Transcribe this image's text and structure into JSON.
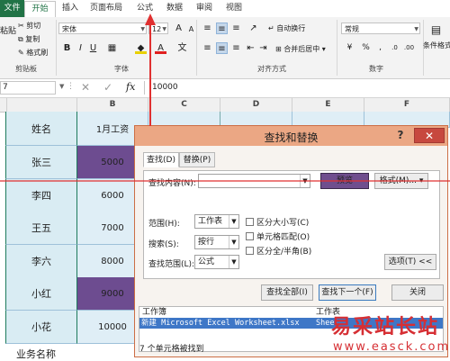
{
  "ribbon_tabs": [
    "文件",
    "开始",
    "插入",
    "页面布局",
    "公式",
    "数据",
    "审阅",
    "视图"
  ],
  "clipboard": {
    "cut": "剪切",
    "copy": "复制",
    "painter": "格式刷",
    "paste": "粘贴",
    "label": "剪贴板"
  },
  "font": {
    "name": "宋体",
    "size": "12",
    "label": "字体",
    "bold": "B",
    "italic": "I",
    "underline": "U",
    "grow": "A",
    "shrink": "A",
    "wen": "文"
  },
  "alignment": {
    "wrap": "自动换行",
    "merge": "合并后居中",
    "label": "对齐方式"
  },
  "number": {
    "format": "常规",
    "label": "数字"
  },
  "styles": {
    "cond": "条件格式"
  },
  "formula_bar": {
    "name_box": "7",
    "cancel": "✕",
    "enter": "✓",
    "fx": "fx",
    "value": "10000"
  },
  "columns": [
    "B",
    "C",
    "D",
    "E",
    "F"
  ],
  "sheet": {
    "header_name": "姓名",
    "header_salary": "1月工资",
    "rows": [
      {
        "name": "张三",
        "salary": "5000",
        "highlight": true
      },
      {
        "name": "李四",
        "salary": "6000",
        "highlight": false
      },
      {
        "name": "王五",
        "salary": "7000",
        "highlight": false
      },
      {
        "name": "李六",
        "salary": "8000",
        "highlight": false
      },
      {
        "name": "小红",
        "salary": "9000",
        "highlight": true
      },
      {
        "name": "小花",
        "salary": "10000",
        "highlight": false
      }
    ],
    "footer": "业务名称"
  },
  "dialog": {
    "title": "查找和替换",
    "help": "?",
    "close": "✕",
    "tab_find": "查找(D)",
    "tab_replace": "替换(P)",
    "find_label": "查找内容(N):",
    "preview": "预览",
    "format_btn": "格式(M)...",
    "scope_label": "范围(H):",
    "scope_value": "工作表",
    "search_label": "搜索(S):",
    "search_value": "按行",
    "lookin_label": "查找范围(L):",
    "lookin_value": "公式",
    "match_case": "区分大小写(C)",
    "match_cell": "单元格匹配(O)",
    "match_width": "区分全/半角(B)",
    "options_btn": "选项(T) <<",
    "find_all": "查找全部(I)",
    "find_next": "查找下一个(F)",
    "close_btn": "关闭",
    "col_workbook": "工作簿",
    "col_sheet": "工作表",
    "result_workbook": "新建 Microsoft Excel Worksheet.xlsx",
    "result_sheet": "Sheet",
    "status": "7 个单元格被找到"
  },
  "watermark": {
    "cn": "易采站长站",
    "url": "www.easck.com"
  },
  "colors": {
    "excel_green": "#217346",
    "highlight": "#6d4c90",
    "dialog_title": "#eba784",
    "close": "#c7483f",
    "annotation": "#e03030"
  }
}
